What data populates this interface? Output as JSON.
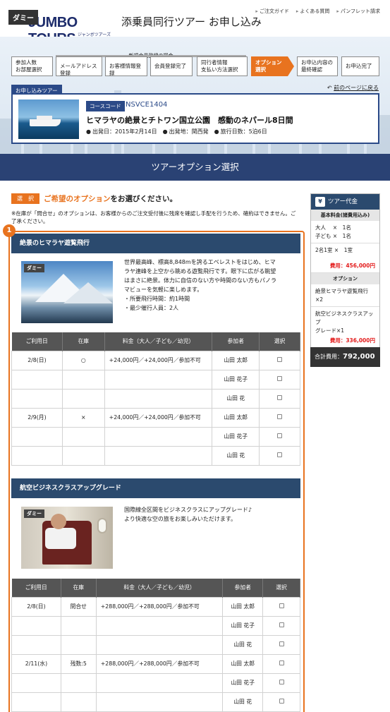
{
  "header": {
    "dummy_label": "ダミー",
    "logo": "JUMBO TOURS",
    "logo_sub": "ジャンボツアーズ",
    "title": "添乗員同行ツアー お申し込み",
    "links": [
      "ご注文ガイド",
      "よくある質問",
      "パンフレット請求"
    ]
  },
  "steps": {
    "member_caption": "新規会員登録の場合",
    "items": [
      {
        "l1": "参加人数",
        "l2": "お部屋選択"
      },
      {
        "l1": "メールアドレス登録",
        "l2": ""
      },
      {
        "l1": "お客様情報登録",
        "l2": ""
      },
      {
        "l1": "会員登録完了",
        "l2": ""
      },
      {
        "l1": "同行者情報",
        "l2": "支払い方法選択"
      },
      {
        "l1": "オプション",
        "l2": "選択"
      },
      {
        "l1": "お申込内容の",
        "l2": "最終確認"
      },
      {
        "l1": "お申込完了",
        "l2": ""
      }
    ]
  },
  "tour": {
    "tag": "お申し込みツアー",
    "back": "前のページに戻る",
    "course_code_label": "コースコード",
    "course_code": "NSVCE1404",
    "name": "ヒマラヤの絶景とチトワン国立公園　感動のネパール8日間",
    "departure": "出発日：2015年2月14日",
    "origin": "出発地：関西発",
    "days": "旅行日数：5泊6日"
  },
  "section_title": "ツアーオプション選択",
  "select": {
    "badge": "選　択",
    "title_hl": "ご希望のオプション",
    "title_rest": "をお選びください。",
    "notice": "※在庫が「問合せ」のオプションは、お客様からのご注文受付後に残席を確認し手配を行うため、確約はできません。ご了承ください。"
  },
  "step_number": "1",
  "options": [
    {
      "title": "絶景のヒマラヤ遊覧飛行",
      "image_label": "ダミー",
      "desc": [
        "世界最高峰、標高8,848mを誇るエベレストをはじめ、ヒマ",
        "ラヤ連峰を上空から眺める遊覧飛行です。眼下に広がる眺望",
        "はまさに絶景。体力に自信のない方や時間のない方もパノラ",
        "マビューを気軽に楽しめます。",
        "・所要飛行時間：約1時間",
        "・最少催行人員：2人"
      ],
      "headers": [
        "ご利用日",
        "在庫",
        "料金（大人／子ども／幼児）",
        "参加者",
        "選択"
      ],
      "rows": [
        [
          "2/8(日)",
          "○",
          "+24,000円／+24,000円／参加不可",
          "山田 太郎"
        ],
        [
          "",
          "",
          "",
          "山田 花子"
        ],
        [
          "",
          "",
          "",
          "山田 花"
        ],
        [
          "2/9(月)",
          "×",
          "+24,000円／+24,000円／参加不可",
          "山田 太郎"
        ],
        [
          "",
          "",
          "",
          "山田 花子"
        ],
        [
          "",
          "",
          "",
          "山田 花"
        ]
      ]
    },
    {
      "title": "航空ビジネスクラスアップグレード",
      "image_label": "ダミー",
      "desc": [
        "国際線全区間をビジネスクラスにアップグレード♪",
        "より快適な空の旅をお楽しみいただけます。"
      ],
      "headers": [
        "ご利用日",
        "在庫",
        "料金（大人／子ども／幼児）",
        "参加者",
        "選択"
      ],
      "rows": [
        [
          "2/8(日)",
          "問合せ",
          "+288,000円／+288,000円／参加不可",
          "山田 太郎"
        ],
        [
          "",
          "",
          "",
          "山田 花子"
        ],
        [
          "",
          "",
          "",
          "山田 花"
        ],
        [
          "2/11(水)",
          "残数:5",
          "+288,000円／+288,000円／参加不可",
          "山田 太郎"
        ],
        [
          "",
          "",
          "",
          "山田 花子"
        ],
        [
          "",
          "",
          "",
          "山田 花"
        ]
      ]
    }
  ],
  "sidebar": {
    "title": "ツアー代金",
    "base_label": "基本料金(諸費用込み)",
    "adults": "大人　 ×　1名",
    "children": "子ども ×　1名",
    "rooms": "2名1室 ×　1室",
    "base_price": "費用：456,000円",
    "option_label": "オプション",
    "option1": "絶景ヒマラヤ遊覧飛行",
    "option1_qty": "×2",
    "option2": "航空ビジネスクラスアップ",
    "option2_qty": "グレード×1",
    "option_price": "費用：336,000円",
    "total_label": "合計費用：",
    "total_value": "792,000円"
  }
}
